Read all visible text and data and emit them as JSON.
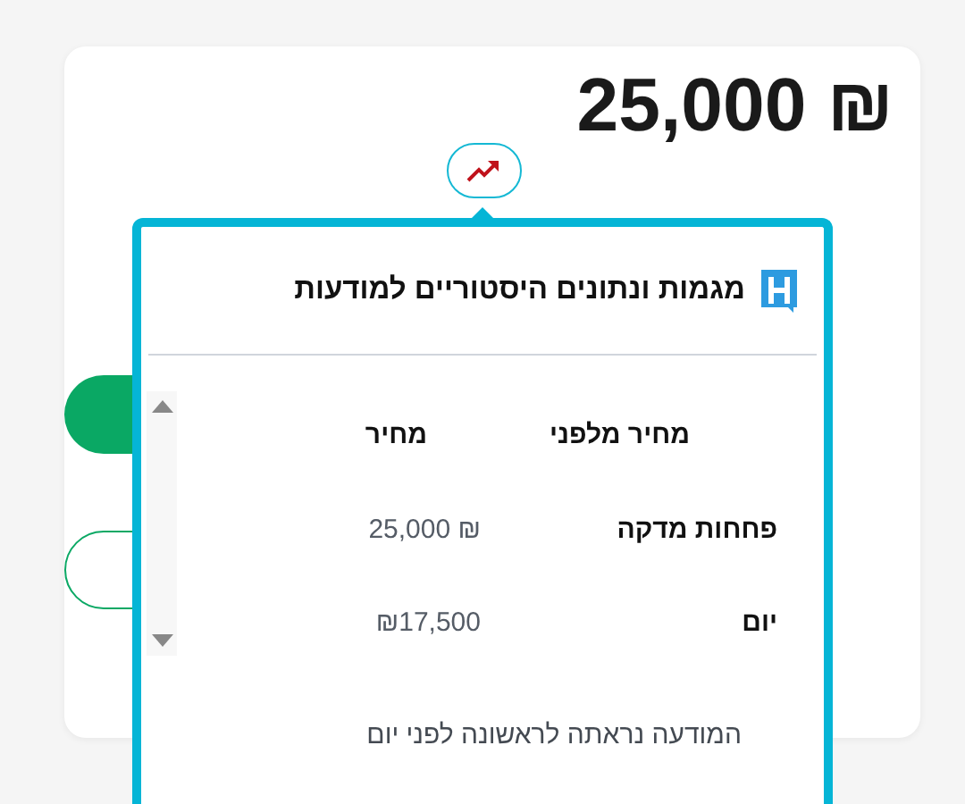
{
  "price": "25,000 ₪",
  "popover": {
    "title": "מגמות ונתונים היסטוריים למודעות",
    "table": {
      "columns": [
        "מחיר מלפני",
        "מחיר"
      ],
      "rows": [
        [
          "פחחות מדקה",
          "25,000 ₪"
        ],
        [
          "יום",
          "₪17,500"
        ]
      ]
    },
    "note": "המודעה נראתה לראשונה לפני יום"
  }
}
